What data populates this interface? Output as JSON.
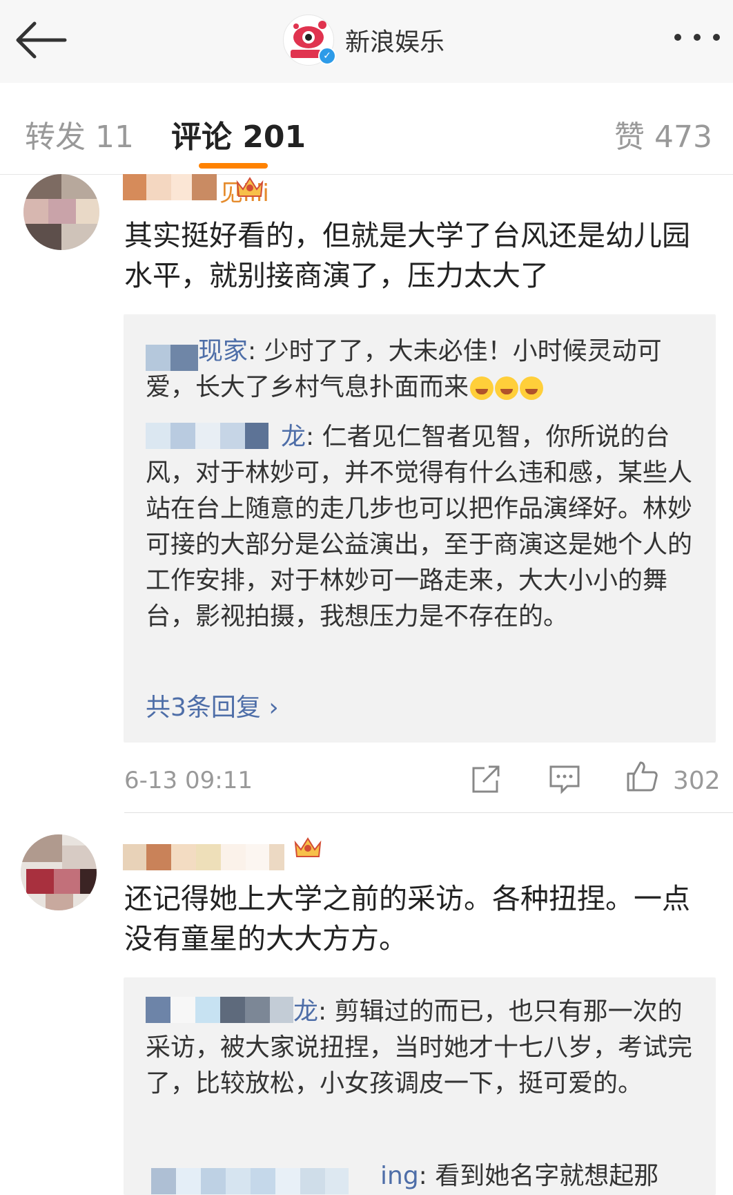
{
  "header": {
    "account_name": "新浪娱乐",
    "back_icon": "arrow-left-icon",
    "more_icon": "more-dots-icon"
  },
  "tabs": {
    "repost": "转发 11",
    "comments": "评论 201",
    "likes": "赞 473",
    "accent": "#ff8200"
  },
  "comments": [
    {
      "nick_visible": "见iiii",
      "text": "其实挺好看的，但就是大学了台风还是幼儿园水平，就别接商演了，压力太大了",
      "replies": [
        {
          "name_visible": "现家",
          "text": ": 少时了了，大未必佳！小时候灵动可爱，长大了乡村气息扑面而来"
        },
        {
          "name_visible": "龙",
          "text": ": 仁者见仁智者见智，你所说的台风，对于林妙可，并不觉得有什么违和感，某些人站在台上随意的走几步也可以把作品演绎好。林妙可接的大部分是公益演出，至于商演这是她个人的工作安排，对于林妙可一路走来，大大小小的舞台，影视拍摄，我想压力是不存在的。"
        }
      ],
      "more_replies": "共3条回复 ›",
      "time": "6-13 09:11",
      "likes": "302"
    },
    {
      "text": "还记得她上大学之前的采访。各种扭捏。一点没有童星的大大方方。",
      "replies": [
        {
          "name_visible": "龙",
          "text": ": 剪辑过的而已，也只有那一次的采访，被大家说扭捏，当时她才十七八岁，考试完了，比较放松，小女孩调皮一下，挺可爱的。"
        },
        {
          "name_visible": "ing",
          "text": ": 看到她名字就想起那"
        }
      ]
    }
  ],
  "colors": {
    "link": "#4e6ea8",
    "muted": "#999999",
    "reply_bg": "#f2f2f2"
  }
}
